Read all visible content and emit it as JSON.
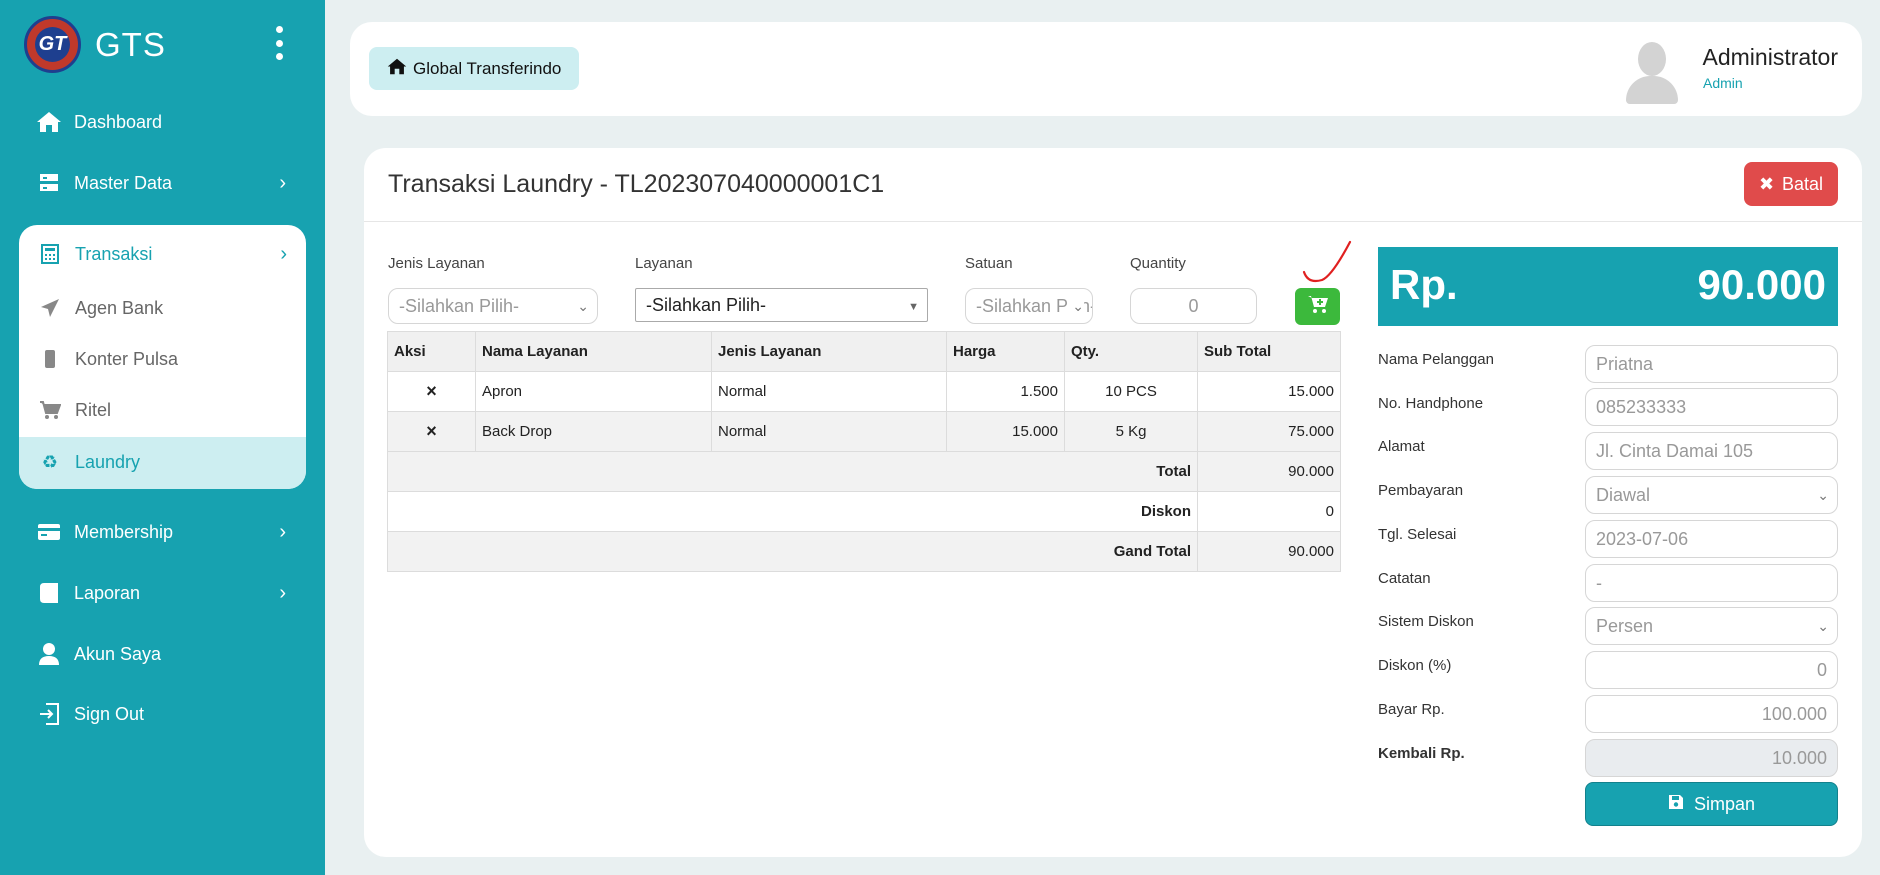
{
  "brand": {
    "name": "GTS",
    "logo_text": "GT"
  },
  "sidebar": {
    "items": [
      {
        "label": "Dashboard",
        "icon": "home-icon"
      },
      {
        "label": "Master Data",
        "icon": "server-icon"
      },
      {
        "label": "Membership",
        "icon": "credit-card-icon"
      },
      {
        "label": "Laporan",
        "icon": "book-icon"
      },
      {
        "label": "Akun Saya",
        "icon": "user-icon"
      },
      {
        "label": "Sign Out",
        "icon": "sign-out-icon"
      }
    ],
    "transaksi": {
      "label": "Transaksi",
      "icon": "calculator-icon",
      "items": [
        {
          "label": "Agen Bank",
          "icon": "paper-plane-icon"
        },
        {
          "label": "Konter Pulsa",
          "icon": "mobile-icon"
        },
        {
          "label": "Ritel",
          "icon": "cart-icon"
        },
        {
          "label": "Laundry",
          "icon": "recycle-icon"
        }
      ]
    }
  },
  "header": {
    "breadcrumb": "Global Transferindo",
    "user_name": "Administrator",
    "user_role": "Admin"
  },
  "main": {
    "title": "Transaksi Laundry - TL202307040000001C1",
    "cancel_label": "Batal",
    "form": {
      "jenis_layanan_label": "Jenis Layanan",
      "jenis_layanan_value": "-Silahkan Pilih-",
      "layanan_label": "Layanan",
      "layanan_value": "-Silahkan Pilih-",
      "satuan_label": "Satuan",
      "satuan_value": "-Silahkan Pilih-",
      "quantity_label": "Quantity",
      "quantity_value": "0"
    },
    "table": {
      "headers": [
        "Aksi",
        "Nama Layanan",
        "Jenis Layanan",
        "Harga",
        "Qty.",
        "Sub Total"
      ],
      "rows": [
        {
          "action": "×",
          "nama": "Apron",
          "jenis": "Normal",
          "harga": "1.500",
          "qty": "10 PCS",
          "subtotal": "15.000"
        },
        {
          "action": "×",
          "nama": "Back Drop",
          "jenis": "Normal",
          "harga": "15.000",
          "qty": "5 Kg",
          "subtotal": "75.000"
        }
      ],
      "total_label": "Total",
      "total_value": "90.000",
      "diskon_label": "Diskon",
      "diskon_value": "0",
      "grand_total_label": "Gand Total",
      "grand_total_value": "90.000"
    },
    "summary": {
      "currency": "Rp.",
      "amount": "90.000",
      "fields": [
        {
          "label": "Nama Pelanggan",
          "value": "Priatna"
        },
        {
          "label": "No. Handphone",
          "value": "085233333"
        },
        {
          "label": "Alamat",
          "value": "Jl. Cinta Damai 105"
        },
        {
          "label": "Pembayaran",
          "value": "Diawal"
        },
        {
          "label": "Tgl. Selesai",
          "value": "2023-07-06"
        },
        {
          "label": "Catatan",
          "value": "-"
        },
        {
          "label": "Sistem Diskon",
          "value": "Persen"
        },
        {
          "label": "Diskon (%)",
          "value": "0"
        },
        {
          "label": "Bayar Rp.",
          "value": "100.000"
        },
        {
          "label": "Kembali Rp.",
          "value": "10.000"
        }
      ],
      "save_label": "Simpan"
    }
  },
  "colors": {
    "primary": "#17a2b0",
    "danger": "#e04b4b",
    "success": "#3cb93c",
    "annotation": "#e02020"
  }
}
